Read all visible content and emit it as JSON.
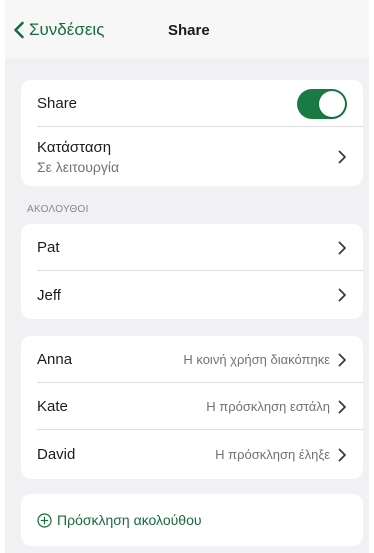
{
  "nav": {
    "back_label": "Συνδέσεις",
    "title": "Share"
  },
  "share_card": {
    "share_label": "Share",
    "share_enabled": true,
    "status_label": "Κατάσταση",
    "status_value": "Σε λειτουργία"
  },
  "followers": {
    "header": "ΑΚΟΛΟΥΘΟΙ",
    "items": [
      {
        "name": "Pat"
      },
      {
        "name": "Jeff"
      }
    ]
  },
  "invites": {
    "items": [
      {
        "name": "Anna",
        "status": "Η κοινή χρήση διακόπηκε"
      },
      {
        "name": "Kate",
        "status": "Η πρόσκληση εστάλη"
      },
      {
        "name": "David",
        "status": "Η πρόσκληση έληξε"
      }
    ]
  },
  "invite_action": {
    "label": "Πρόσκληση ακολούθου"
  },
  "colors": {
    "accent": "#156b3c",
    "toggle_on": "#187b43",
    "background": "#f1f1f3",
    "card": "#ffffff"
  }
}
